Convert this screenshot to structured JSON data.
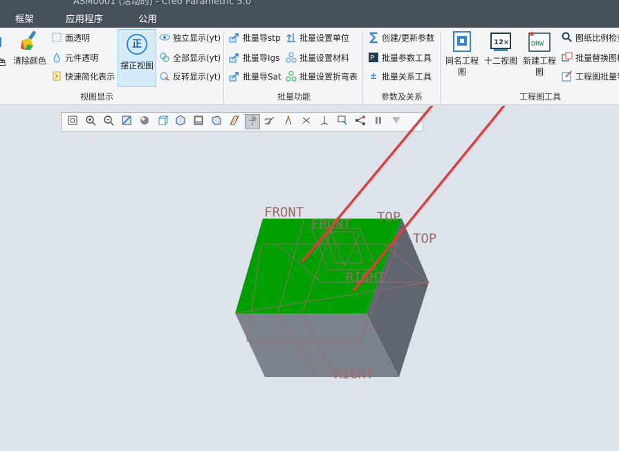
{
  "title_partial": "ASM0001 (活动的) - Creo Parametric 5.0",
  "menu": {
    "items": [
      "框架",
      "应用程序",
      "公用"
    ]
  },
  "ribbon": {
    "view_group": {
      "label": "视图显示",
      "color_label": "色",
      "clear_color": "清除颜色",
      "face_transparent": "面透明",
      "component_transparent": "元件透明",
      "quick_simplify": "快速简化表示",
      "align_view": "摆正视图",
      "align_view_glyph": "正",
      "isolate_display": "独立显示(yt)",
      "show_all": "全部显示(yt)",
      "invert_display": "反转显示(yt)"
    },
    "batch_group": {
      "label": "批量功能",
      "export_stp": "批量导stp",
      "export_igs": "批量导Igs",
      "export_sat": "批量导Sat",
      "set_units": "批量设置单位",
      "set_material": "批量设置材料",
      "set_bend": "批量设置折弯表"
    },
    "param_group": {
      "label": "参数及关系",
      "create_update": "创建/更新参数",
      "param_tool": "批量参数工具",
      "relation_tool": "批量关系工具"
    },
    "drawing_group": {
      "label": "工程图工具",
      "same_name": "同名工程图",
      "twelve_view": "十二视图",
      "new_drawing": "新建工程图",
      "scale_check": "图纸比例检查",
      "batch_replace": "批量替换图框",
      "batch_drawing": "工程图批量导出"
    }
  },
  "graphics_toolbar": {
    "icons": [
      "zoom-fit-icon",
      "zoom-in-icon",
      "zoom-out-icon",
      "repaint-icon",
      "shading-icon",
      "display-style-icon",
      "saved-views-icon",
      "view-manager-icon",
      "perspective-icon",
      "plane-display-icon",
      "axis-display-icon",
      "point-display-icon",
      "csys-display-icon",
      "spin-center-icon",
      "annotation-display-icon",
      "datum-csys-icon",
      "more-datum-icon",
      "pause-icon",
      "next-icon"
    ],
    "active_index": 10
  },
  "model": {
    "datum_labels": [
      "FRONT",
      "FRONT",
      "TOP",
      "TOP",
      "RIGHT",
      "RIGHT"
    ],
    "colors": {
      "top_face": "#00a000",
      "side_face": "#6c737c",
      "front_face": "#7c838d",
      "datum": "#9a6b6b",
      "arrow": "#e83a3a"
    }
  }
}
